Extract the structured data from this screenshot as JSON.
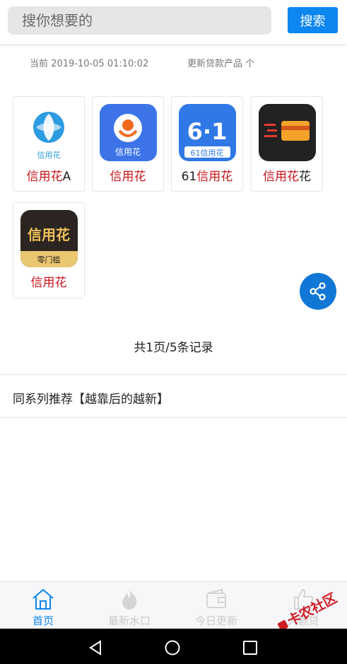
{
  "search": {
    "placeholder": "搜你想要的",
    "button_label": "搜索"
  },
  "meta": {
    "current_prefix": "当前",
    "current_time": "2019-10-05 01:10:02",
    "update_text": "更新贷款产品 个"
  },
  "apps": [
    {
      "name_red": "信用花",
      "name_black": "A",
      "icon_text": "信用花"
    },
    {
      "name_red": "信用花",
      "name_black": "",
      "icon_text": "信用花"
    },
    {
      "name_prefix_black": "61",
      "name_red": "信用花",
      "name_black": "",
      "icon_text_top": "6·1",
      "icon_text": "61信用花"
    },
    {
      "name_red": "信用花",
      "name_black": "花"
    },
    {
      "name_red": "信用花",
      "name_black": "",
      "icon_text": "信用花",
      "icon_subtext": "零门槛"
    }
  ],
  "pager": "共1页/5条记录",
  "series_title": "同系列推荐【越靠后的越新】",
  "tabs": [
    {
      "label": "首页",
      "icon": "home-icon",
      "active": true
    },
    {
      "label": "最新水口",
      "icon": "fire-icon",
      "active": false
    },
    {
      "label": "今日更新",
      "icon": "wallet-icon",
      "active": false
    },
    {
      "label": "大额贷",
      "icon": "thumbs-up-icon",
      "active": false
    }
  ],
  "watermark": "卡农社区",
  "colors": {
    "accent": "#0d86f0",
    "brand_red": "#c8161d",
    "fab": "#1177d6"
  }
}
